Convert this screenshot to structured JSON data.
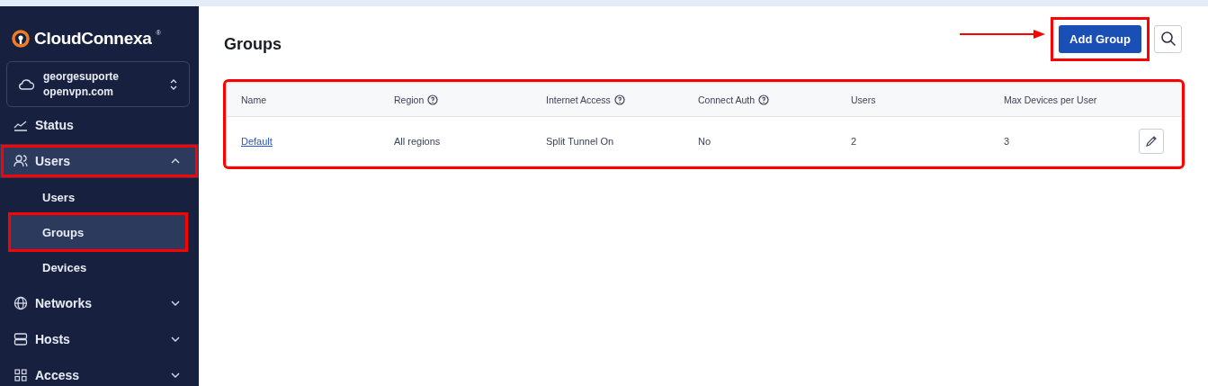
{
  "brand": {
    "name": "CloudConnexa",
    "mark": "®"
  },
  "account": {
    "line1": "georgesuporte",
    "line2": "openvpn.com"
  },
  "nav": [
    {
      "label": "Status",
      "kind": "item",
      "expanded": false,
      "selected": false,
      "highlighted": false
    },
    {
      "label": "Users",
      "kind": "group",
      "expanded": true,
      "selected": false,
      "highlighted": true,
      "children": [
        {
          "label": "Users",
          "selected": false,
          "highlighted": false
        },
        {
          "label": "Groups",
          "selected": true,
          "highlighted": true
        },
        {
          "label": "Devices",
          "selected": false,
          "highlighted": false
        }
      ]
    },
    {
      "label": "Networks",
      "kind": "group",
      "expanded": false,
      "selected": false,
      "highlighted": false
    },
    {
      "label": "Hosts",
      "kind": "group",
      "expanded": false,
      "selected": false,
      "highlighted": false
    },
    {
      "label": "Access",
      "kind": "group",
      "expanded": false,
      "selected": false,
      "highlighted": false
    }
  ],
  "page": {
    "title": "Groups",
    "add_button": {
      "label": "Add Group",
      "highlighted": true
    }
  },
  "table": {
    "highlighted": true,
    "columns": [
      {
        "label": "Name",
        "help": false
      },
      {
        "label": "Region",
        "help": true
      },
      {
        "label": "Internet Access",
        "help": true
      },
      {
        "label": "Connect Auth",
        "help": true
      },
      {
        "label": "Users",
        "help": false
      },
      {
        "label": "Max Devices per User",
        "help": false
      }
    ],
    "rows": [
      {
        "name": "Default",
        "region": "All regions",
        "internet_access": "Split Tunnel On",
        "connect_auth": "No",
        "users": "2",
        "max_devices": "3"
      }
    ]
  }
}
